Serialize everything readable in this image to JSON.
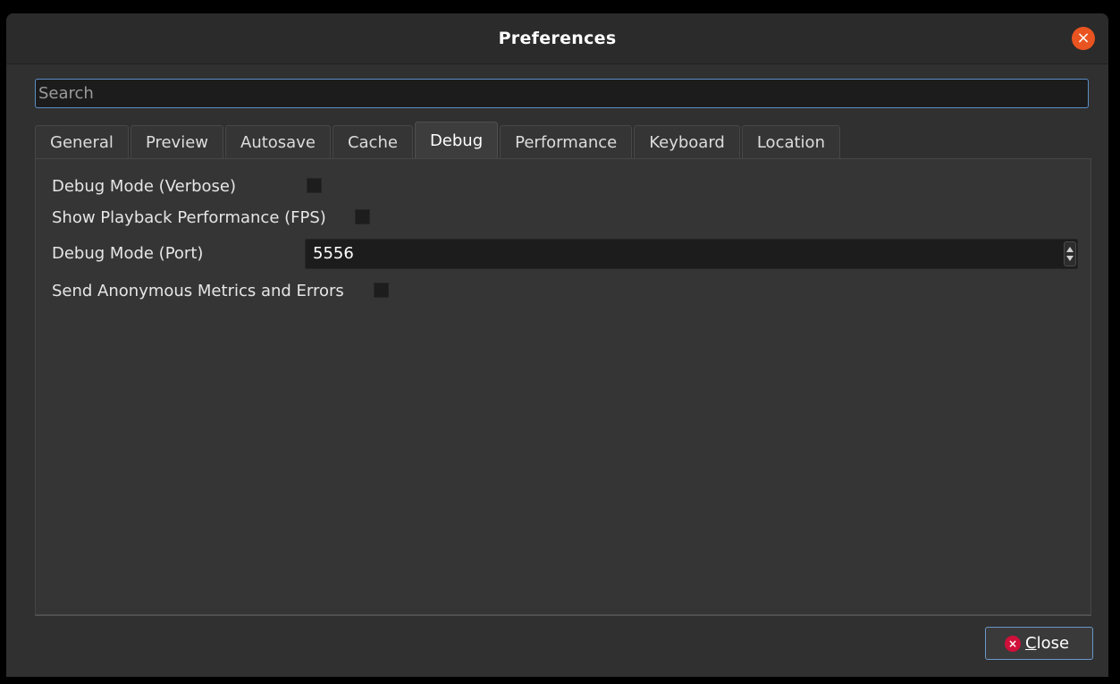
{
  "window": {
    "title": "Preferences"
  },
  "search": {
    "placeholder": "Search",
    "value": ""
  },
  "tabs": [
    {
      "label": "General",
      "active": false
    },
    {
      "label": "Preview",
      "active": false
    },
    {
      "label": "Autosave",
      "active": false
    },
    {
      "label": "Cache",
      "active": false
    },
    {
      "label": "Debug",
      "active": true
    },
    {
      "label": "Performance",
      "active": false
    },
    {
      "label": "Keyboard",
      "active": false
    },
    {
      "label": "Location",
      "active": false
    }
  ],
  "debug": {
    "verbose_label": "Debug Mode (Verbose)",
    "verbose_checked": false,
    "fps_label": "Show Playback Performance (FPS)",
    "fps_checked": false,
    "port_label": "Debug Mode (Port)",
    "port_value": "5556",
    "metrics_label": "Send Anonymous Metrics and Errors",
    "metrics_checked": false
  },
  "footer": {
    "close_mnemonic": "C",
    "close_rest": "lose"
  },
  "colors": {
    "background": "#303030",
    "accent": "#e95420",
    "focus": "#5b8ec5",
    "close_icon": "#d0103a"
  },
  "icons": {
    "window_close": "close-icon",
    "button_close": "close-circle-icon",
    "spin": "spinner-arrows-icon"
  }
}
